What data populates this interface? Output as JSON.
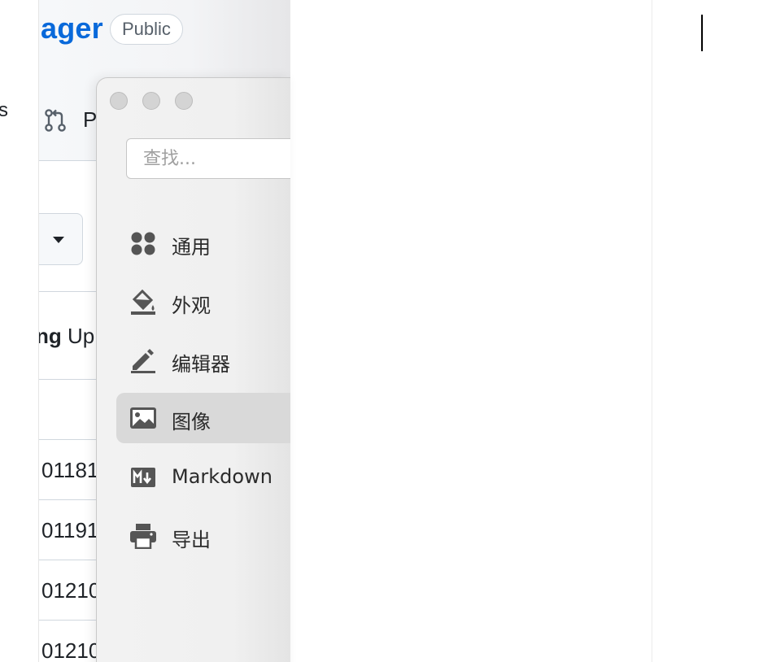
{
  "left_strip": {
    "partial_text": "s"
  },
  "repo_page": {
    "repo_name_partial": "ager",
    "visibility_badge": "Public",
    "tab_partial_label": "P",
    "column_header": {
      "bold_part": "ng",
      "rest": " Up"
    },
    "rows": [
      "01181",
      "01191",
      "01210",
      "01210"
    ]
  },
  "prefs_window": {
    "search_placeholder": "查找...",
    "nav_items": [
      {
        "label": "通用",
        "icon": "apps-grid-icon",
        "selected": false
      },
      {
        "label": "外观",
        "icon": "paint-bucket-icon",
        "selected": false
      },
      {
        "label": "编辑器",
        "icon": "pencil-edit-icon",
        "selected": false
      },
      {
        "label": "图像",
        "icon": "image-icon",
        "selected": true
      },
      {
        "label": "Markdown",
        "icon": "markdown-icon",
        "selected": false
      },
      {
        "label": "导出",
        "icon": "printer-icon",
        "selected": false
      }
    ]
  },
  "colors": {
    "repo_link": "#0969da",
    "nav_selected_bg": "#d9d9d9",
    "icon_gray": "#555555"
  }
}
